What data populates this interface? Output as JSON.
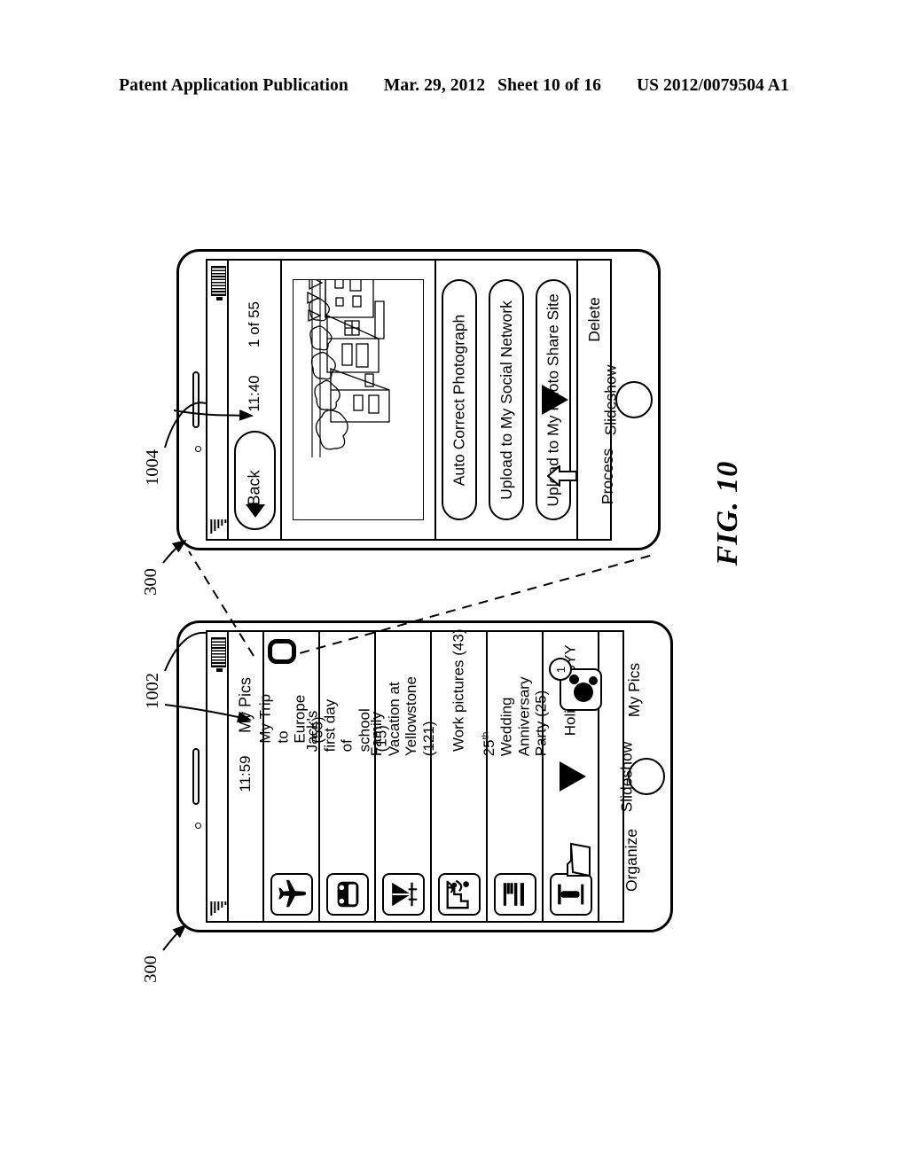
{
  "header": {
    "publication": "Patent Application Publication",
    "date": "Mar. 29, 2012",
    "sheet": "Sheet 10 of 16",
    "number": "US 2012/0079504 A1"
  },
  "figure": {
    "label": "FIG. 10"
  },
  "refs": {
    "device_top": "300",
    "screen_top": "1004",
    "device_bottom": "300",
    "screen_bottom": "1002"
  },
  "photo_viewer": {
    "status": {
      "time": "11:40"
    },
    "counter": "1 of 55",
    "back_button": "Back",
    "back_icon": "triangle-down-icon",
    "photo_alt": "house-line-drawing",
    "actions": [
      {
        "label": "Auto Correct Photograph"
      },
      {
        "label": "Upload to My Social Network"
      },
      {
        "label": "Upload to My Photo Share Site"
      }
    ],
    "toolbar": [
      {
        "label": "Process",
        "icon": "arrow-up-outline-icon"
      },
      {
        "label": "Slideshow",
        "icon": "play-triangle-icon"
      },
      {
        "label": "Delete",
        "icon": "none"
      }
    ]
  },
  "album_list": {
    "status": {
      "time": "11:59"
    },
    "title": "My Pics",
    "albums": [
      {
        "name": "My Trip to Europe (55)",
        "icon": "airplane-icon",
        "selected": true
      },
      {
        "name": "Jack's first day of\nschool (15)",
        "icon": "bus-icon",
        "selected": false
      },
      {
        "name": "Family Vacation at\nYellowstone (121)",
        "icon": "tent-icon",
        "selected": false
      },
      {
        "name": "Work pictures (43)",
        "icon": "chart-people-icon",
        "selected": false
      },
      {
        "name": "25th Wedding\nAnniversary Party (25)",
        "icon": "fork-knife-icon",
        "selected": false,
        "superscript": "th",
        "superscript_after": "25"
      },
      {
        "name": "Holiday 20YY",
        "icon": "candle-icon",
        "selected": false
      }
    ],
    "toolbar": [
      {
        "label": "My Pics",
        "icon": "mouse-icon",
        "badge": "1"
      },
      {
        "label": "Organize",
        "icon": "folder-icon",
        "badge": ""
      },
      {
        "label": "Slideshow",
        "icon": "play-triangle-icon",
        "badge": ""
      }
    ]
  }
}
